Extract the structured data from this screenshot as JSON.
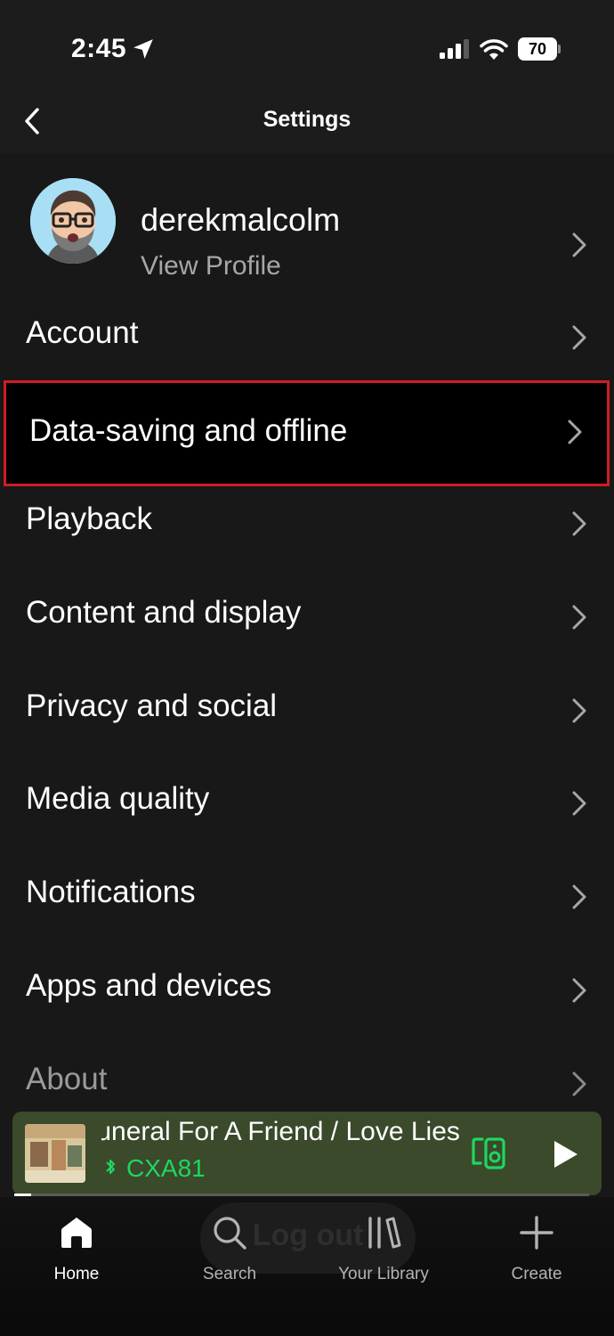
{
  "status_bar": {
    "time": "2:45",
    "battery": "70",
    "icons": [
      "location-arrow-icon",
      "cellular-signal-icon",
      "wifi-icon",
      "battery-icon"
    ]
  },
  "header": {
    "title": "Settings",
    "back_icon": "chevron-left-icon"
  },
  "profile": {
    "name": "derekmalcolm",
    "subtitle": "View Profile"
  },
  "menu": {
    "items": [
      {
        "label": "Account"
      },
      {
        "label": "Data-saving and offline",
        "highlighted": true
      },
      {
        "label": "Playback"
      },
      {
        "label": "Content and display"
      },
      {
        "label": "Privacy and social"
      },
      {
        "label": "Media quality"
      },
      {
        "label": "Notifications"
      },
      {
        "label": "Apps and devices"
      },
      {
        "label": "About"
      }
    ]
  },
  "player": {
    "track": "Funeral For A Friend / Love Lies Bleeding",
    "device": "CXA81",
    "progress": 0.03
  },
  "ghost_button": {
    "label": "Log out"
  },
  "nav": {
    "items": [
      {
        "label": "Home",
        "icon": "home-icon",
        "active": true
      },
      {
        "label": "Search",
        "icon": "search-icon"
      },
      {
        "label": "Your Library",
        "icon": "library-icon"
      },
      {
        "label": "Create",
        "icon": "plus-icon"
      }
    ]
  },
  "colors": {
    "accent_green": "#1ed760",
    "highlight_border": "#d01c24",
    "player_background": "#3a4a2b"
  }
}
